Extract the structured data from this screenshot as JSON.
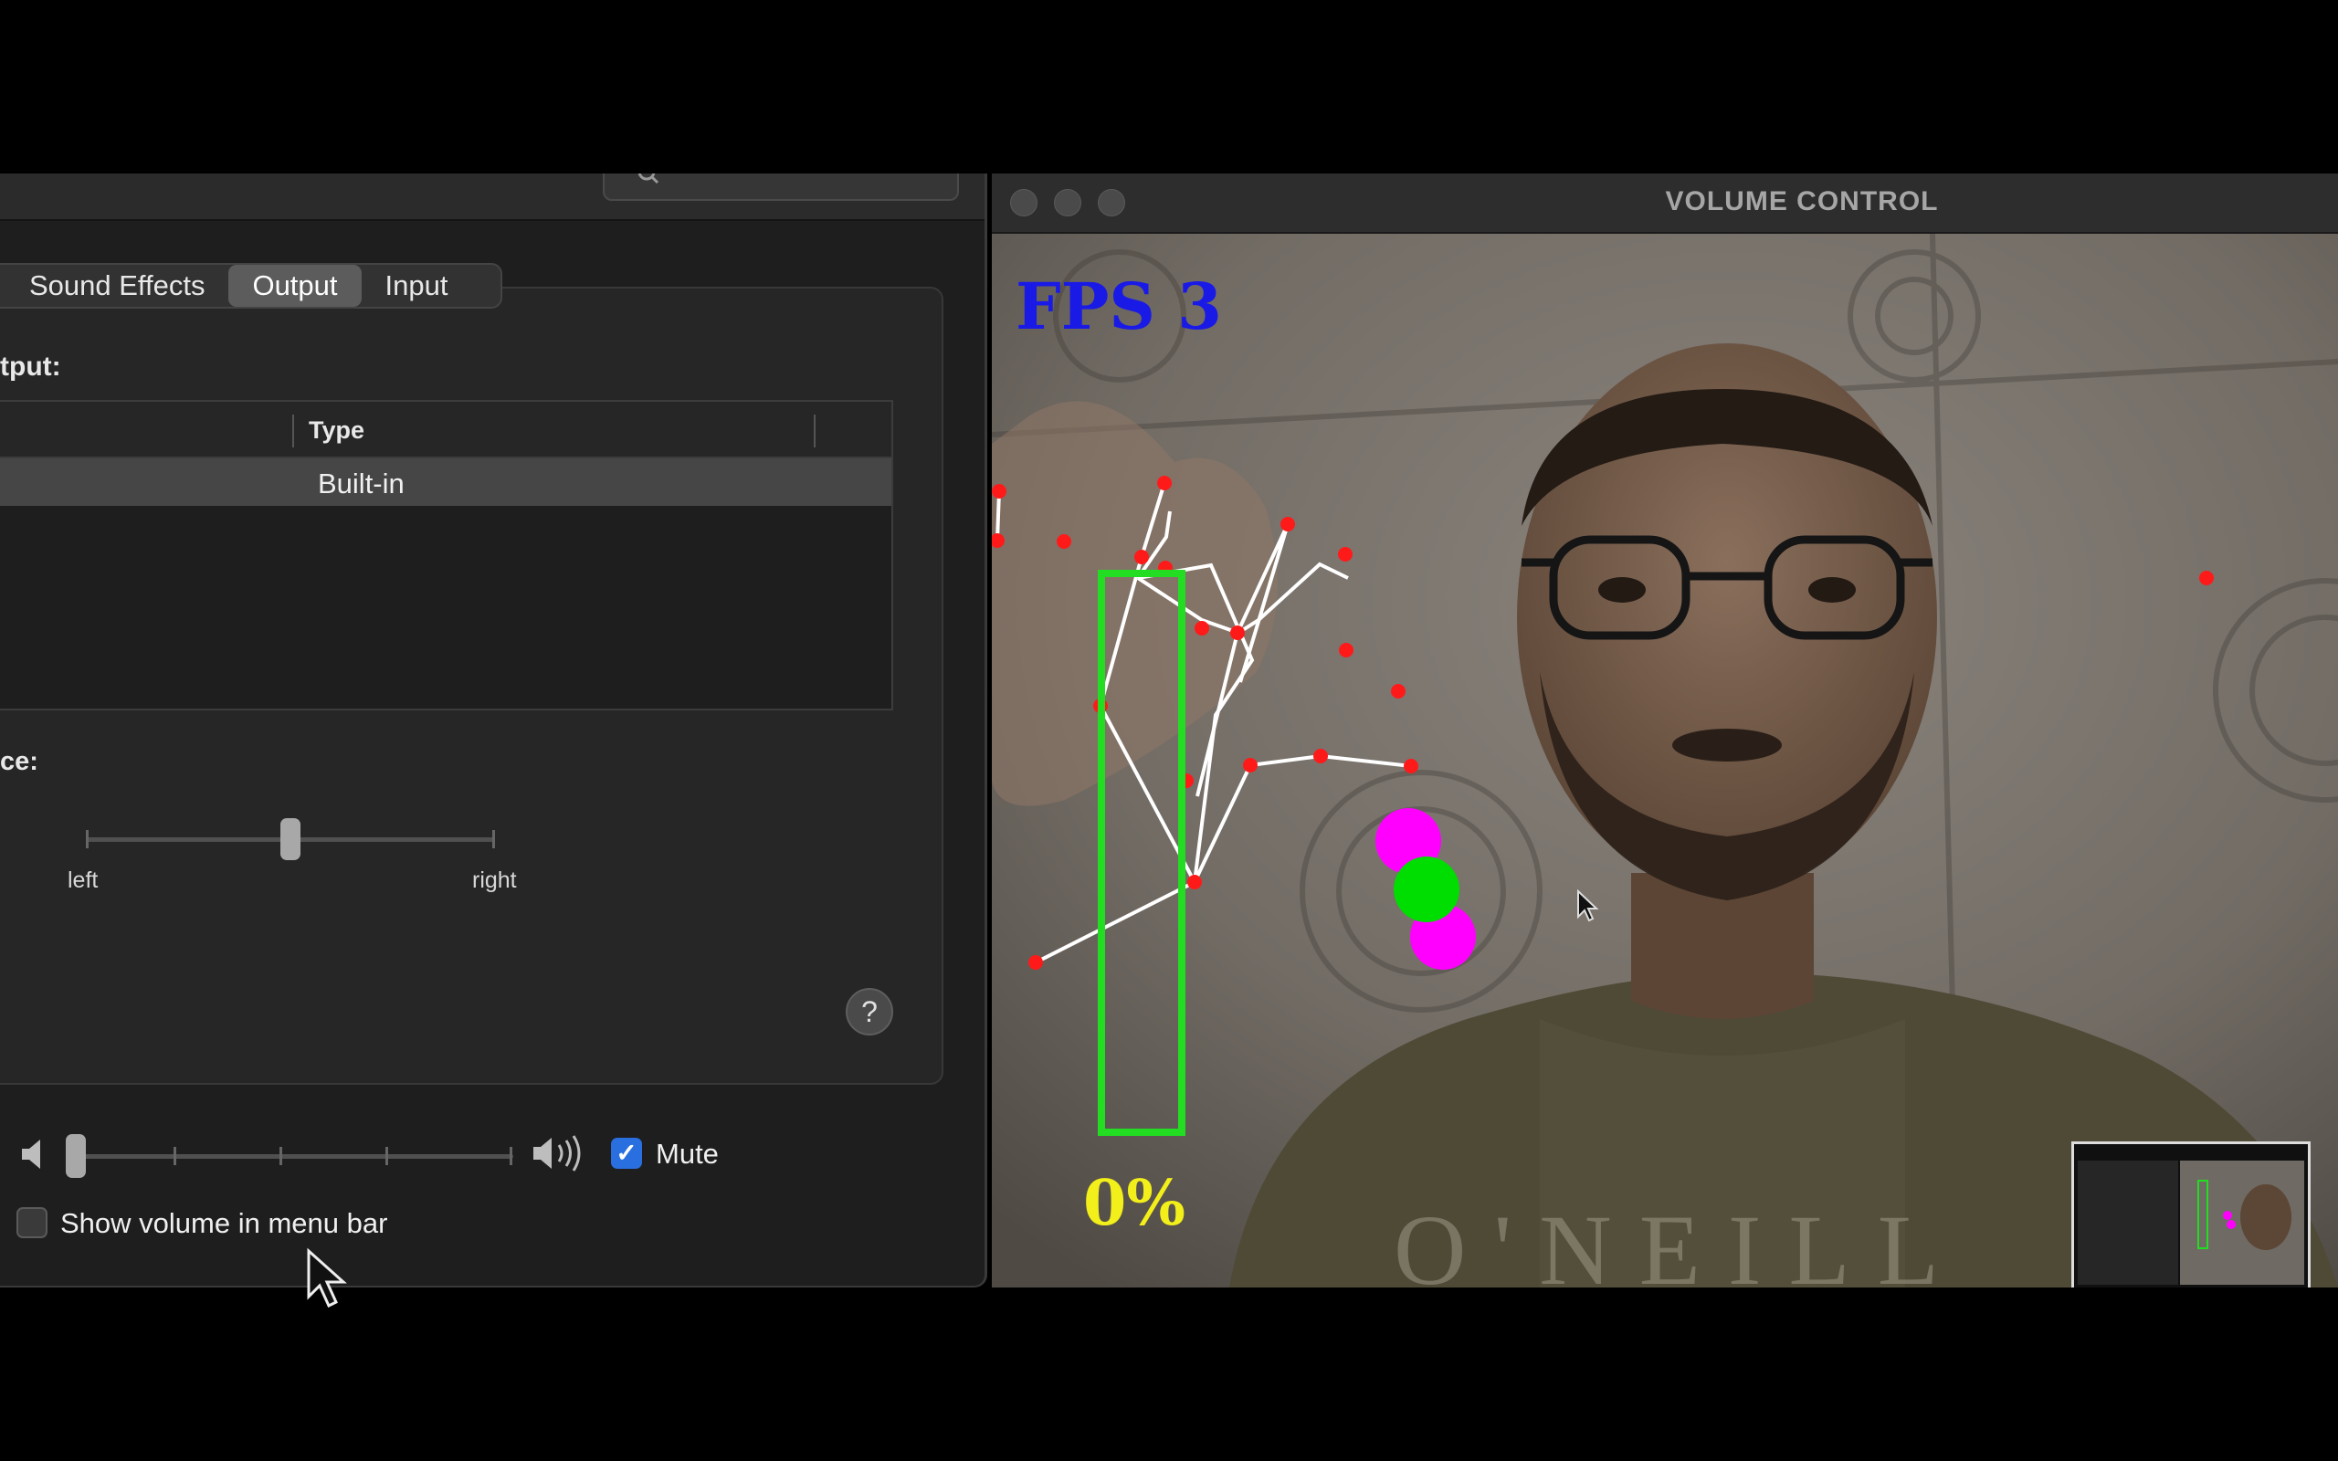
{
  "sound_prefs": {
    "tabs": [
      {
        "label": "Sound Effects",
        "active": false
      },
      {
        "label": "Output",
        "active": true
      },
      {
        "label": "Input",
        "active": false
      }
    ],
    "output_heading": "tput:",
    "table": {
      "column_type": "Type",
      "rows": [
        {
          "type": "Built-in",
          "selected": true
        }
      ]
    },
    "balance_heading": "ce:",
    "balance_left_label": "left",
    "balance_right_label": "right",
    "balance_value": 0.5,
    "help_label": "?",
    "output_volume": 0,
    "mute_label": "Mute",
    "mute_checked": true,
    "show_volume_label": "Show volume in menu bar",
    "show_volume_checked": false,
    "icons": [
      "search-icon",
      "speaker-low-icon",
      "speaker-high-icon",
      "checkmark-icon",
      "help-icon"
    ]
  },
  "camera_window": {
    "title": "VOLUME CONTROL",
    "fps_text": "FPS 3",
    "volume_percent_text": "0%",
    "volume_bar_fill": 0,
    "colors": {
      "fps": "#1a1ae6",
      "volume_bar": "#22dd22",
      "landmarks": "#ff1a1a",
      "fingertips": "#ff00ff",
      "midpoint": "#00dd00",
      "percent": "#f2ef1a"
    }
  }
}
